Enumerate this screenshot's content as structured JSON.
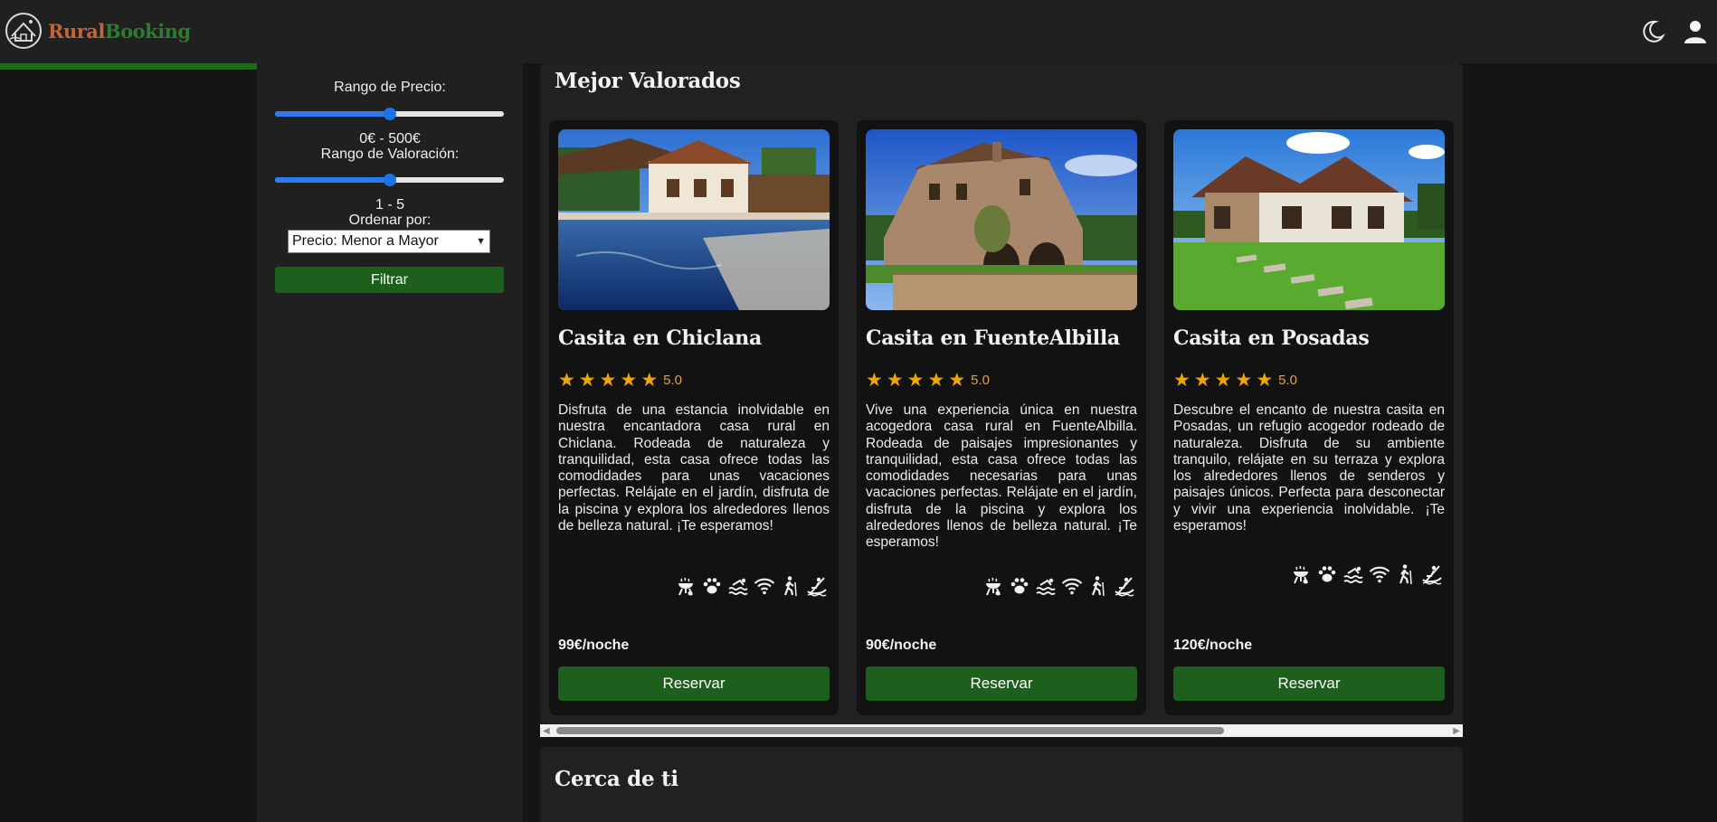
{
  "header": {
    "brand_part1": "Rural",
    "brand_part2": "Booking",
    "icons": [
      "house-logo-icon",
      "moon-icon",
      "user-icon"
    ]
  },
  "page_progress": 0.26,
  "filters": {
    "price_label": "Rango de Precio:",
    "price_value_text": "0€ - 500€",
    "price_slider_position": 0.5,
    "rating_label": "Rango de Valoración:",
    "rating_value_text": "1 - 5",
    "rating_slider_position": 0.5,
    "sort_label": "Ordenar por:",
    "sort_selected": "Precio: Menor a Mayor",
    "filter_button": "Filtrar"
  },
  "top_rated": {
    "title": "Mejor Valorados",
    "cards": [
      {
        "title": "Casita en Chiclana",
        "rating": "5.0",
        "stars": 5,
        "description": "Disfruta de una estancia inolvidable en nuestra encantadora casa rural en Chiclana. Rodeada de naturaleza y tranquilidad, esta casa ofrece todas las comodidades para unas vacaciones perfectas. Relájate en el jardín, disfruta de la piscina y explora los alrededores llenos de belleza natural. ¡Te esperamos!",
        "amenities": [
          "bbq-icon",
          "pets-icon",
          "pool-icon",
          "wifi-icon",
          "hiking-icon",
          "kayak-icon"
        ],
        "price": "99€/noche",
        "book_label": "Reservar"
      },
      {
        "title": "Casita en FuenteAlbilla",
        "rating": "5.0",
        "stars": 5,
        "description": "Vive una experiencia única en nuestra acogedora casa rural en FuenteAlbilla. Rodeada de paisajes impresionantes y tranquilidad, esta casa ofrece todas las comodidades necesarias para unas vacaciones perfectas. Relájate en el jardín, disfruta de la piscina y explora los alrededores llenos de belleza natural. ¡Te esperamos!",
        "amenities": [
          "bbq-icon",
          "pets-icon",
          "pool-icon",
          "wifi-icon",
          "hiking-icon",
          "kayak-icon"
        ],
        "price": "90€/noche",
        "book_label": "Reservar"
      },
      {
        "title": "Casita en Posadas",
        "rating": "5.0",
        "stars": 5,
        "description": "Descubre el encanto de nuestra casita en Posadas, un refugio acogedor rodeado de naturaleza. Disfruta de su ambiente tranquilo, relájate en su terraza y explora los alrededores llenos de senderos y paisajes únicos. Perfecta para desconectar y vivir una experiencia inolvidable. ¡Te esperamos!",
        "amenities": [
          "bbq-icon",
          "pets-icon",
          "pool-icon",
          "wifi-icon",
          "hiking-icon",
          "kayak-icon"
        ],
        "price": "120€/noche",
        "book_label": "Reservar"
      }
    ]
  },
  "nearby": {
    "title": "Cerca de ti"
  },
  "colors": {
    "brand_orange": "#c0673a",
    "brand_green": "#2f7a2f",
    "button_green": "#1d5f1d",
    "star_gold": "#f0a500"
  }
}
